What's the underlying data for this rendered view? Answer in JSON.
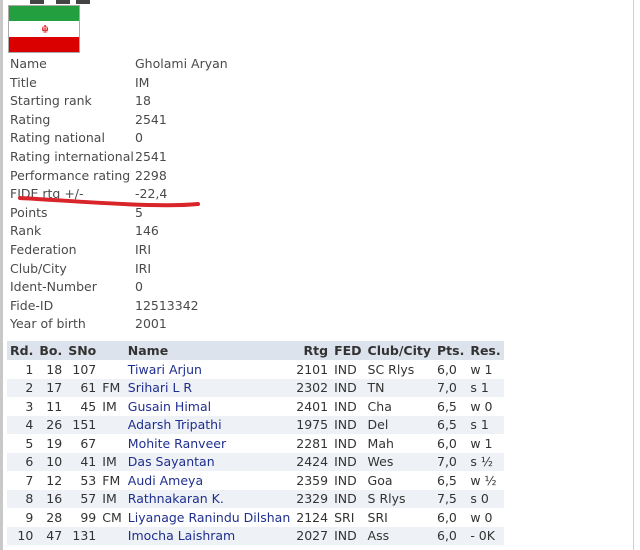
{
  "player": {
    "flag_icon": "iran-flag-icon",
    "fields": [
      {
        "label": "Name",
        "value": "Gholami Aryan"
      },
      {
        "label": "Title",
        "value": "IM"
      },
      {
        "label": "Starting rank",
        "value": "18"
      },
      {
        "label": "Rating",
        "value": "2541"
      },
      {
        "label": "Rating national",
        "value": "0"
      },
      {
        "label": "Rating international",
        "value": "2541"
      },
      {
        "label": "Performance rating",
        "value": "2298"
      },
      {
        "label": "FIDE rtg +/-",
        "value": "-22,4"
      },
      {
        "label": "Points",
        "value": "5"
      },
      {
        "label": "Rank",
        "value": "146"
      },
      {
        "label": "Federation",
        "value": "IRI"
      },
      {
        "label": "Club/City",
        "value": "IRI"
      },
      {
        "label": "Ident-Number",
        "value": "0"
      },
      {
        "label": "Fide-ID",
        "value": "12513342"
      },
      {
        "label": "Year of birth",
        "value": "2001"
      }
    ]
  },
  "colors": {
    "underline": "#d9252a",
    "header_bg": "#dde3ec",
    "link": "#1f2f8f"
  },
  "games": {
    "headers": [
      "Rd.",
      "Bo.",
      "SNo",
      "",
      "Name",
      "Rtg",
      "FED",
      "Club/City",
      "Pts.",
      "Res."
    ],
    "rows": [
      [
        "1",
        "18",
        "107",
        "",
        "Tiwari Arjun",
        "2101",
        "IND",
        "SC Rlys",
        "6,0",
        "w 1"
      ],
      [
        "2",
        "17",
        "61",
        "FM",
        "Srihari L R",
        "2302",
        "IND",
        "TN",
        "7,0",
        "s 1"
      ],
      [
        "3",
        "11",
        "45",
        "IM",
        "Gusain Himal",
        "2401",
        "IND",
        "Cha",
        "6,5",
        "w 0"
      ],
      [
        "4",
        "26",
        "151",
        "",
        "Adarsh Tripathi",
        "1975",
        "IND",
        "Del",
        "6,5",
        "s 1"
      ],
      [
        "5",
        "19",
        "67",
        "",
        "Mohite Ranveer",
        "2281",
        "IND",
        "Mah",
        "6,0",
        "w 1"
      ],
      [
        "6",
        "10",
        "41",
        "IM",
        "Das Sayantan",
        "2424",
        "IND",
        "Wes",
        "7,0",
        "s ½"
      ],
      [
        "7",
        "12",
        "53",
        "FM",
        "Audi Ameya",
        "2359",
        "IND",
        "Goa",
        "6,5",
        "w ½"
      ],
      [
        "8",
        "16",
        "57",
        "IM",
        "Rathnakaran K.",
        "2329",
        "IND",
        "S Rlys",
        "7,5",
        "s 0"
      ],
      [
        "9",
        "28",
        "99",
        "CM",
        "Liyanage Ranindu Dilshan",
        "2124",
        "SRI",
        "SRI",
        "6,0",
        "w 0"
      ],
      [
        "10",
        "47",
        "131",
        "",
        "Imocha Laishram",
        "2027",
        "IND",
        "Ass",
        "6,0",
        "- 0K"
      ]
    ]
  }
}
